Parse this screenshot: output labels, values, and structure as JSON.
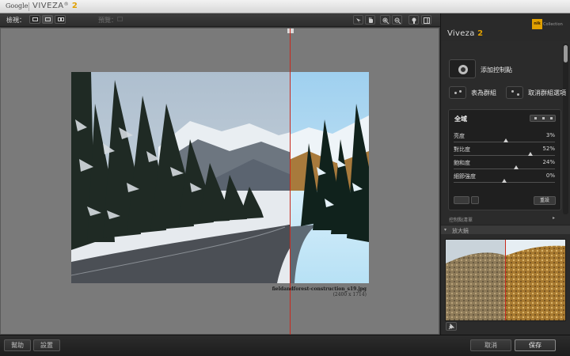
{
  "titlebar": {
    "google": "Google",
    "app_name": "VIVEZA",
    "reg": "®",
    "version": "2"
  },
  "toolbar": {
    "view_label": "檢視：",
    "preview_label": "預覽：",
    "preview_value": "☐"
  },
  "canvas": {
    "file_name": "fieldandforest-construction_s19.jpg",
    "file_size": "(2400 x 1714)"
  },
  "panel": {
    "title": "Viveza",
    "version": "2",
    "badge_logo": "nik",
    "badge_text": "Collection",
    "add_point_label": "添加控制點",
    "group_label": "表為群組",
    "ungroup_label": "取消群組選項",
    "global": {
      "title": "全域",
      "sliders": [
        {
          "label": "亮度",
          "value": "3%",
          "level": 0.515
        },
        {
          "label": "對比度",
          "value": "52%",
          "level": 0.76
        },
        {
          "label": "飽和度",
          "value": "24%",
          "level": 0.62
        },
        {
          "label": "細節強度",
          "value": "0%",
          "level": 0.5
        }
      ],
      "reset_label": "重設"
    },
    "control_points_label": "控制點清單",
    "loupe_label": "放大鏡"
  },
  "bottombar": {
    "help_label": "幫助",
    "settings_label": "設置",
    "cancel_label": "取消",
    "save_label": "保存"
  },
  "colors": {
    "accent": "#e0a000",
    "split_line": "#c82a1e"
  }
}
